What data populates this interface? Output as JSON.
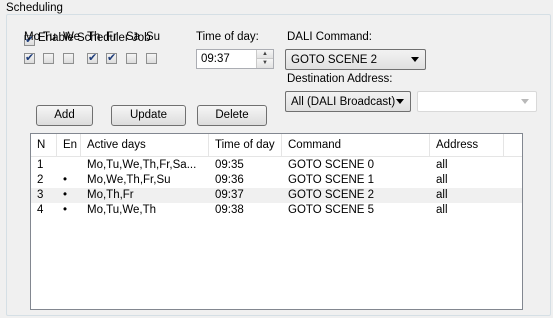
{
  "group": {
    "title": "Scheduling"
  },
  "enable_job": {
    "label": "Enable Scheduler Job",
    "checked": true
  },
  "days": [
    {
      "label": "Mo",
      "checked": true
    },
    {
      "label": "Tu",
      "checked": false
    },
    {
      "label": "We",
      "checked": false
    },
    {
      "label": "Th",
      "checked": true
    },
    {
      "label": "Fr",
      "checked": true
    },
    {
      "label": "Sa",
      "checked": false
    },
    {
      "label": "Su",
      "checked": false
    }
  ],
  "time_of_day": {
    "label": "Time of day:",
    "value": "09:37"
  },
  "dali_command": {
    "label": "DALI Command:",
    "value": "GOTO SCENE 2"
  },
  "destination": {
    "label": "Destination Address:",
    "value": "All (DALI Broadcast)",
    "secondary_value": ""
  },
  "buttons": {
    "add": "Add",
    "update": "Update",
    "delete": "Delete"
  },
  "table": {
    "columns": [
      "N",
      "En",
      "Active days",
      "Time of day",
      "Command",
      "Address"
    ],
    "rows": [
      {
        "n": "1",
        "en": "",
        "days": "Mo,Tu,We,Th,Fr,Sa...",
        "time": "09:35",
        "command": "GOTO SCENE 0",
        "address": "all",
        "selected": false
      },
      {
        "n": "2",
        "en": "•",
        "days": "Mo,We,Th,Fr,Su",
        "time": "09:36",
        "command": "GOTO SCENE 1",
        "address": "all",
        "selected": false
      },
      {
        "n": "3",
        "en": "•",
        "days": "Mo,Th,Fr",
        "time": "09:37",
        "command": "GOTO SCENE 2",
        "address": "all",
        "selected": true
      },
      {
        "n": "4",
        "en": "•",
        "days": "Mo,Tu,We,Th",
        "time": "09:38",
        "command": "GOTO SCENE 5",
        "address": "all",
        "selected": false
      }
    ]
  }
}
